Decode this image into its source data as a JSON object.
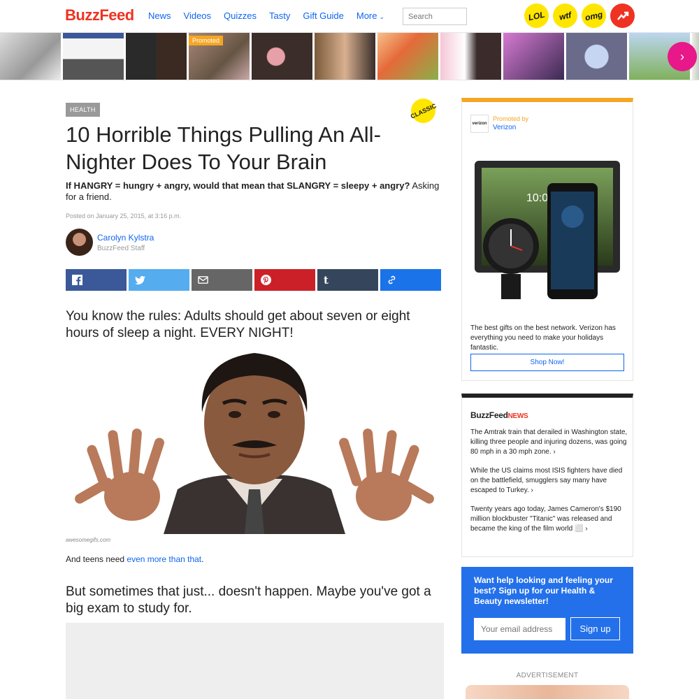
{
  "header": {
    "logo": "BuzzFeed",
    "nav": [
      "News",
      "Videos",
      "Quizzes",
      "Tasty",
      "Gift Guide",
      "More"
    ],
    "search_placeholder": "Search",
    "badges": [
      "LOL",
      "wtf",
      "omg"
    ]
  },
  "strip": {
    "promoted_label": "Promoted"
  },
  "article": {
    "section": "HEALTH",
    "classic_badge": "CLASSIC",
    "title": "10 Horrible Things Pulling An All-Nighter Does To Your Brain",
    "dek_bold": "If HANGRY = hungry + angry, would that mean that SLANGRY = sleepy + angry?",
    "dek_rest": " Asking for a friend.",
    "posted": "Posted on January 25, 2015, at 3:16 p.m.",
    "author": "Carolyn Kylstra",
    "author_role": "BuzzFeed Staff",
    "subhead1": "You know the rules: Adults should get about seven or eight hours of sleep a night. EVERY NIGHT!",
    "gif_credit": "awesomegifs.com",
    "para_start": "And teens need ",
    "para_link": "even more than that",
    "para_end": ".",
    "subhead2": "But sometimes that just... doesn't happen. Maybe you've got a big exam to study for."
  },
  "share": {
    "buttons": [
      {
        "name": "facebook",
        "color": "#3b5998"
      },
      {
        "name": "twitter",
        "color": "#55acee"
      },
      {
        "name": "email",
        "color": "#666666"
      },
      {
        "name": "pinterest",
        "color": "#cb2027"
      },
      {
        "name": "tumblr",
        "color": "#35465c"
      },
      {
        "name": "link",
        "color": "#1a73e8"
      }
    ]
  },
  "sidebar": {
    "ad": {
      "logo_text": "verizon",
      "promoted_by": "Promoted by",
      "sponsor": "Verizon",
      "body": "The best gifts on the best network. Verizon has everything you need to make your holidays fantastic.",
      "cta": "Shop Now!",
      "screen_time": "10:00"
    },
    "news": {
      "logo_main": "BuzzFeed",
      "logo_sub": "NEWS",
      "items": [
        "The Amtrak train that derailed in Washington state, killing three people and injuring dozens, was going 80 mph in a 30 mph zone. ›",
        "While the US claims most ISIS fighters have died on the battlefield, smugglers say many have escaped to Turkey. ›",
        "Twenty years ago today, James Cameron's $190 million blockbuster \"Titanic\" was released and became the king of the film world ⬜ ›"
      ]
    },
    "newsletter": {
      "title": "Want help looking and feeling your best? Sign up for our Health & Beauty newsletter!",
      "placeholder": "Your email address",
      "button": "Sign up"
    },
    "advertisement_label": "ADVERTISEMENT"
  },
  "colors": {
    "brand_red": "#ee3322",
    "link_blue": "#0f65ef",
    "promo_orange": "#f6a623",
    "badge_yellow": "#ffe600"
  }
}
